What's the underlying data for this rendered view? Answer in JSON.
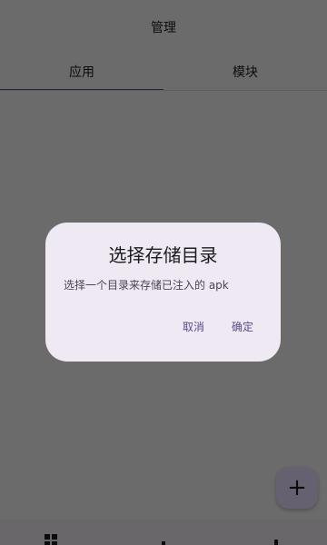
{
  "header": {
    "title": "管理"
  },
  "tabs": [
    {
      "label": "应用",
      "active": true
    },
    {
      "label": "模块",
      "active": false
    }
  ],
  "fab": {
    "label": "+",
    "icon": "add-icon"
  },
  "bottom_nav": {
    "icons": [
      "grid-icon",
      "nav-icon",
      "nav-icon"
    ]
  },
  "dialog": {
    "title": "选择存储目录",
    "message": "选择一个目录来存储已注入的 apk",
    "cancel_label": "取消",
    "confirm_label": "确定"
  },
  "colors": {
    "accent": "#5a4b86",
    "dialog_bg": "#efe9f4",
    "scrim": "rgba(0,0,0,0.56)"
  }
}
